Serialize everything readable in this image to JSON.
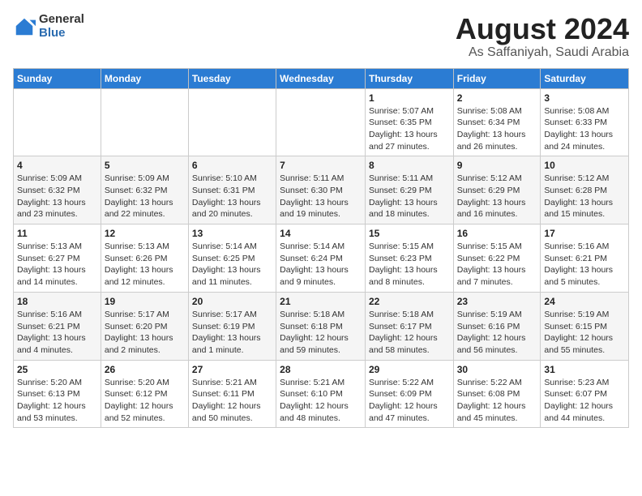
{
  "header": {
    "logo_general": "General",
    "logo_blue": "Blue",
    "main_title": "August 2024",
    "sub_title": "As Saffaniyah, Saudi Arabia"
  },
  "days_of_week": [
    "Sunday",
    "Monday",
    "Tuesday",
    "Wednesday",
    "Thursday",
    "Friday",
    "Saturday"
  ],
  "weeks": [
    [
      {
        "day": "",
        "info": ""
      },
      {
        "day": "",
        "info": ""
      },
      {
        "day": "",
        "info": ""
      },
      {
        "day": "",
        "info": ""
      },
      {
        "day": "1",
        "info": "Sunrise: 5:07 AM\nSunset: 6:35 PM\nDaylight: 13 hours\nand 27 minutes."
      },
      {
        "day": "2",
        "info": "Sunrise: 5:08 AM\nSunset: 6:34 PM\nDaylight: 13 hours\nand 26 minutes."
      },
      {
        "day": "3",
        "info": "Sunrise: 5:08 AM\nSunset: 6:33 PM\nDaylight: 13 hours\nand 24 minutes."
      }
    ],
    [
      {
        "day": "4",
        "info": "Sunrise: 5:09 AM\nSunset: 6:32 PM\nDaylight: 13 hours\nand 23 minutes."
      },
      {
        "day": "5",
        "info": "Sunrise: 5:09 AM\nSunset: 6:32 PM\nDaylight: 13 hours\nand 22 minutes."
      },
      {
        "day": "6",
        "info": "Sunrise: 5:10 AM\nSunset: 6:31 PM\nDaylight: 13 hours\nand 20 minutes."
      },
      {
        "day": "7",
        "info": "Sunrise: 5:11 AM\nSunset: 6:30 PM\nDaylight: 13 hours\nand 19 minutes."
      },
      {
        "day": "8",
        "info": "Sunrise: 5:11 AM\nSunset: 6:29 PM\nDaylight: 13 hours\nand 18 minutes."
      },
      {
        "day": "9",
        "info": "Sunrise: 5:12 AM\nSunset: 6:29 PM\nDaylight: 13 hours\nand 16 minutes."
      },
      {
        "day": "10",
        "info": "Sunrise: 5:12 AM\nSunset: 6:28 PM\nDaylight: 13 hours\nand 15 minutes."
      }
    ],
    [
      {
        "day": "11",
        "info": "Sunrise: 5:13 AM\nSunset: 6:27 PM\nDaylight: 13 hours\nand 14 minutes."
      },
      {
        "day": "12",
        "info": "Sunrise: 5:13 AM\nSunset: 6:26 PM\nDaylight: 13 hours\nand 12 minutes."
      },
      {
        "day": "13",
        "info": "Sunrise: 5:14 AM\nSunset: 6:25 PM\nDaylight: 13 hours\nand 11 minutes."
      },
      {
        "day": "14",
        "info": "Sunrise: 5:14 AM\nSunset: 6:24 PM\nDaylight: 13 hours\nand 9 minutes."
      },
      {
        "day": "15",
        "info": "Sunrise: 5:15 AM\nSunset: 6:23 PM\nDaylight: 13 hours\nand 8 minutes."
      },
      {
        "day": "16",
        "info": "Sunrise: 5:15 AM\nSunset: 6:22 PM\nDaylight: 13 hours\nand 7 minutes."
      },
      {
        "day": "17",
        "info": "Sunrise: 5:16 AM\nSunset: 6:21 PM\nDaylight: 13 hours\nand 5 minutes."
      }
    ],
    [
      {
        "day": "18",
        "info": "Sunrise: 5:16 AM\nSunset: 6:21 PM\nDaylight: 13 hours\nand 4 minutes."
      },
      {
        "day": "19",
        "info": "Sunrise: 5:17 AM\nSunset: 6:20 PM\nDaylight: 13 hours\nand 2 minutes."
      },
      {
        "day": "20",
        "info": "Sunrise: 5:17 AM\nSunset: 6:19 PM\nDaylight: 13 hours\nand 1 minute."
      },
      {
        "day": "21",
        "info": "Sunrise: 5:18 AM\nSunset: 6:18 PM\nDaylight: 12 hours\nand 59 minutes."
      },
      {
        "day": "22",
        "info": "Sunrise: 5:18 AM\nSunset: 6:17 PM\nDaylight: 12 hours\nand 58 minutes."
      },
      {
        "day": "23",
        "info": "Sunrise: 5:19 AM\nSunset: 6:16 PM\nDaylight: 12 hours\nand 56 minutes."
      },
      {
        "day": "24",
        "info": "Sunrise: 5:19 AM\nSunset: 6:15 PM\nDaylight: 12 hours\nand 55 minutes."
      }
    ],
    [
      {
        "day": "25",
        "info": "Sunrise: 5:20 AM\nSunset: 6:13 PM\nDaylight: 12 hours\nand 53 minutes."
      },
      {
        "day": "26",
        "info": "Sunrise: 5:20 AM\nSunset: 6:12 PM\nDaylight: 12 hours\nand 52 minutes."
      },
      {
        "day": "27",
        "info": "Sunrise: 5:21 AM\nSunset: 6:11 PM\nDaylight: 12 hours\nand 50 minutes."
      },
      {
        "day": "28",
        "info": "Sunrise: 5:21 AM\nSunset: 6:10 PM\nDaylight: 12 hours\nand 48 minutes."
      },
      {
        "day": "29",
        "info": "Sunrise: 5:22 AM\nSunset: 6:09 PM\nDaylight: 12 hours\nand 47 minutes."
      },
      {
        "day": "30",
        "info": "Sunrise: 5:22 AM\nSunset: 6:08 PM\nDaylight: 12 hours\nand 45 minutes."
      },
      {
        "day": "31",
        "info": "Sunrise: 5:23 AM\nSunset: 6:07 PM\nDaylight: 12 hours\nand 44 minutes."
      }
    ]
  ]
}
